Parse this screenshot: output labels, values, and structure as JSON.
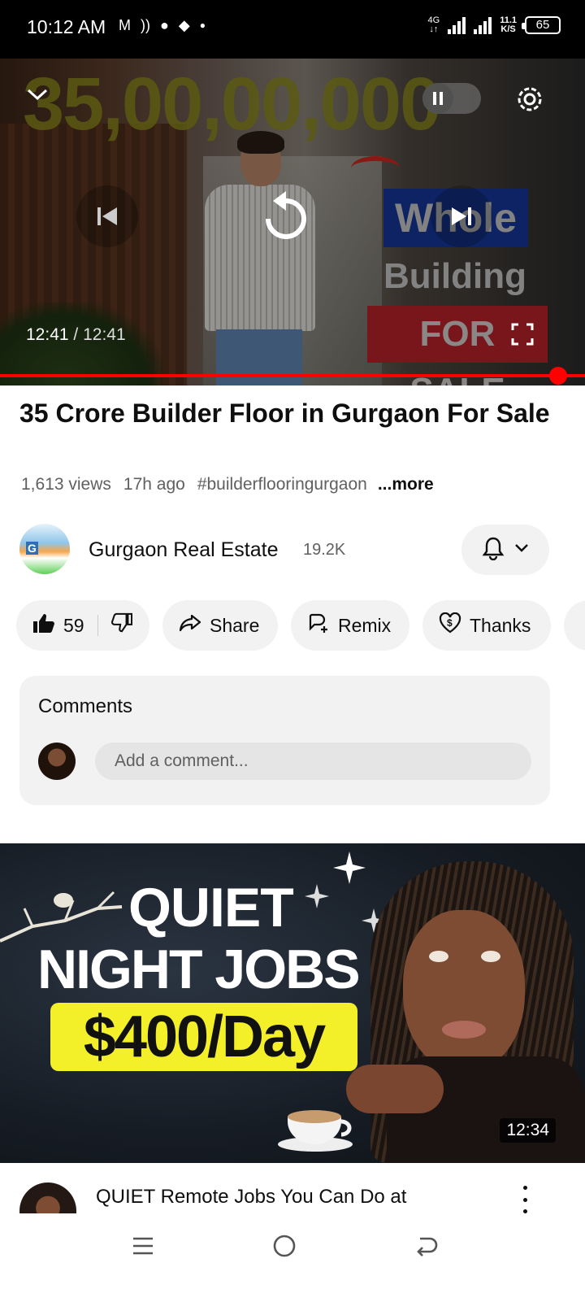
{
  "status_bar": {
    "time": "10:12 AM",
    "network": "4G",
    "speed_value": "11.1",
    "speed_unit": "K/S",
    "battery": "65"
  },
  "player": {
    "overlay_text": {
      "price": "35,00,00,000",
      "whole": "Whole",
      "building": "Building",
      "for_sale": "FOR SALE"
    },
    "current_time": "12:41",
    "separator": "/",
    "total_time": "12:41",
    "progress": 1.0,
    "accent_color": "#ff0000"
  },
  "video": {
    "title": "35 Crore Builder Floor in Gurgaon For Sale",
    "views": "1,613 views",
    "age": "17h ago",
    "hashtag": "#builderflooringurgaon",
    "more": "...more"
  },
  "channel": {
    "name": "Gurgaon Real Estate",
    "subscribers": "19.2K"
  },
  "actions": {
    "likes": "59",
    "share": "Share",
    "remix": "Remix",
    "thanks": "Thanks"
  },
  "comments": {
    "label": "Comments",
    "placeholder": "Add a comment..."
  },
  "next_video": {
    "thumb_line1": "QUIET",
    "thumb_line2": "NIGHT JOBS",
    "thumb_line3": "$400/Day",
    "duration": "12:34",
    "title": "QUIET Remote Jobs You Can Do at"
  },
  "icons": {
    "collapse": "chevron-down-icon",
    "pause": "pause-icon",
    "settings": "gear-icon",
    "previous": "skip-previous-icon",
    "replay": "replay-icon",
    "next": "skip-next-icon",
    "fullscreen": "fullscreen-icon",
    "bell": "bell-icon",
    "like": "thumbs-up-icon",
    "dislike": "thumbs-down-icon"
  }
}
